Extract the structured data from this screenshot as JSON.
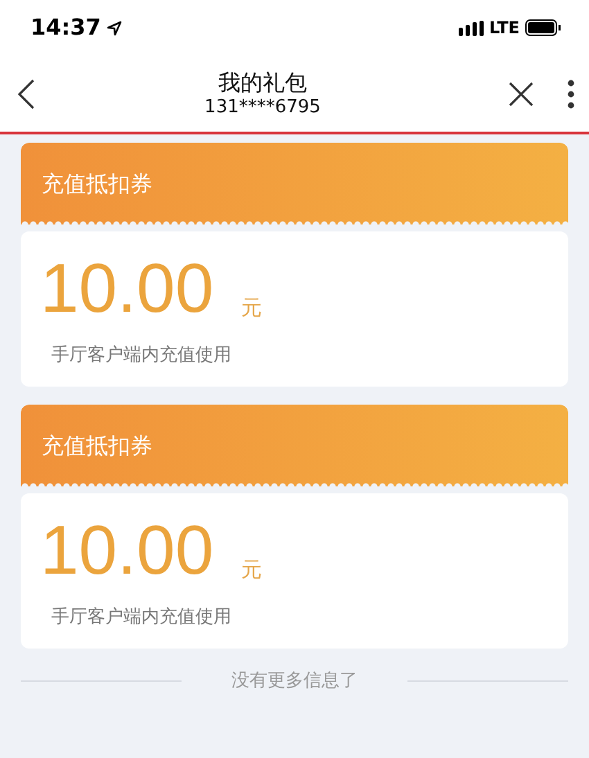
{
  "status_bar": {
    "time": "14:37",
    "network": "LTE"
  },
  "nav": {
    "title": "我的礼包",
    "subtitle": "131****6795"
  },
  "coupons": [
    {
      "title": "充值抵扣券",
      "amount": "10.00",
      "unit": "元",
      "description": "手厅客户端内充值使用"
    },
    {
      "title": "充值抵扣券",
      "amount": "10.00",
      "unit": "元",
      "description": "手厅客户端内充值使用"
    }
  ],
  "footer": "没有更多信息了"
}
